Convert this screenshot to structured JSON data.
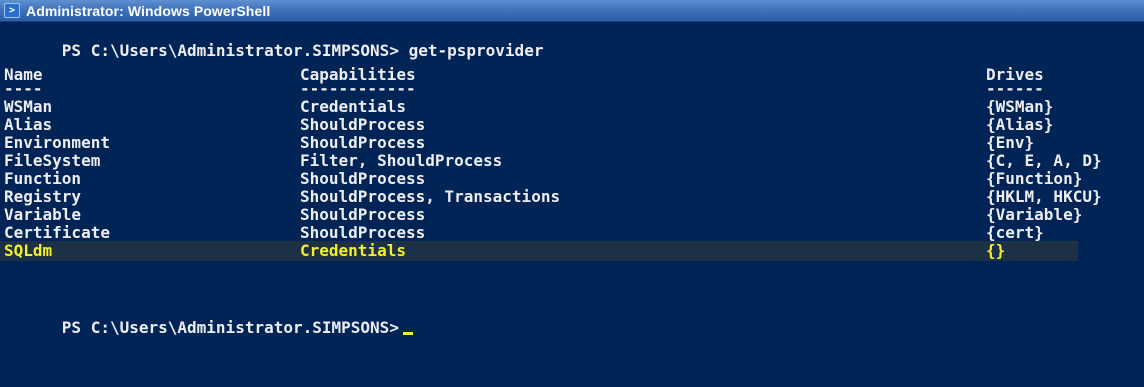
{
  "window": {
    "title": "Administrator: Windows PowerShell",
    "icon": "powershell-icon"
  },
  "console": {
    "prompt": "PS C:\\Users\\Administrator.SIMPSONS>",
    "command": "get-psprovider",
    "headers": {
      "name": "Name",
      "capabilities": "Capabilities",
      "drives": "Drives"
    },
    "underlines": {
      "name": "----",
      "capabilities": "------------",
      "drives": "------"
    },
    "rows": [
      {
        "name": "WSMan",
        "capabilities": "Credentials",
        "drives": "{WSMan}"
      },
      {
        "name": "Alias",
        "capabilities": "ShouldProcess",
        "drives": "{Alias}"
      },
      {
        "name": "Environment",
        "capabilities": "ShouldProcess",
        "drives": "{Env}"
      },
      {
        "name": "FileSystem",
        "capabilities": "Filter, ShouldProcess",
        "drives": "{C, E, A, D}"
      },
      {
        "name": "Function",
        "capabilities": "ShouldProcess",
        "drives": "{Function}"
      },
      {
        "name": "Registry",
        "capabilities": "ShouldProcess, Transactions",
        "drives": "{HKLM, HKCU}"
      },
      {
        "name": "Variable",
        "capabilities": "ShouldProcess",
        "drives": "{Variable}"
      },
      {
        "name": "Certificate",
        "capabilities": "ShouldProcess",
        "drives": "{cert}"
      },
      {
        "name": "SQLdm",
        "capabilities": "Credentials",
        "drives": "{}"
      }
    ],
    "highlighted_row": 8,
    "final_prompt": "PS C:\\Users\\Administrator.SIMPSONS>"
  },
  "colors": {
    "background": "#012456",
    "text": "#eeedf0",
    "highlight_text": "#f3ef2e",
    "highlight_background": "#1d3145"
  }
}
